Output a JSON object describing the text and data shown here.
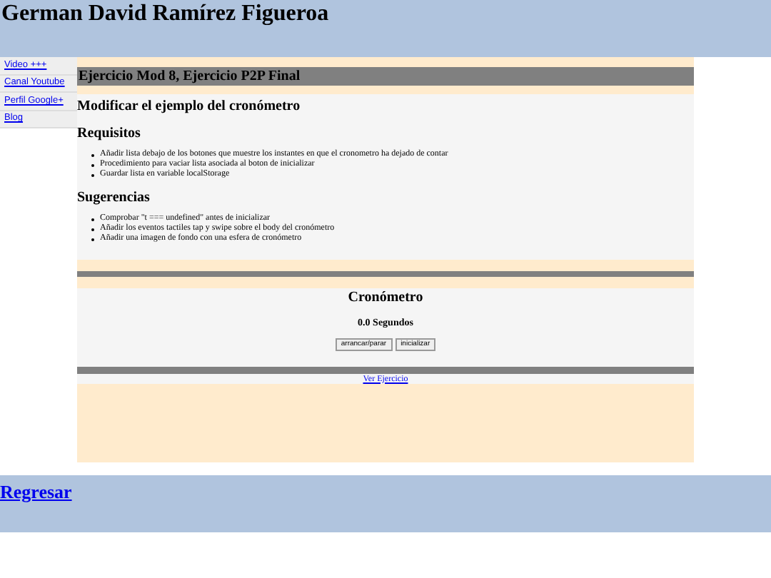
{
  "header": {
    "title": "German David Ramírez Figueroa"
  },
  "sidebar": {
    "items": [
      {
        "label": "Video +++"
      },
      {
        "label": "Canal Youtube"
      },
      {
        "label": "Perfil Google+"
      },
      {
        "label": "Blog"
      }
    ]
  },
  "main": {
    "title": "Ejercicio Mod 8, Ejercicio P2P Final",
    "heading": "Modificar el ejemplo del cronómetro",
    "sections": [
      {
        "title": "Requisitos",
        "items": [
          "Añadir lista debajo de los botones que muestre los instantes en que el cronometro ha dejado de contar",
          "Procedimiento para vaciar lista asociada al boton de inicializar",
          "Guardar lista en variable localStorage"
        ]
      },
      {
        "title": "Sugerencias",
        "items": [
          "Comprobar \"t === undefined\" antes de inicializar",
          "Añadir los eventos tactiles tap y swipe sobre el body del cronómetro",
          "Añadir una imagen de fondo con una esfera de cronómetro"
        ]
      }
    ],
    "stopwatch": {
      "title": "Cronómetro",
      "reading": "0.0 Segundos",
      "buttons": [
        "arrancar/parar",
        "inicializar"
      ]
    },
    "link": "Ver Ejercicio"
  },
  "footer": {
    "link": "Regresar"
  }
}
